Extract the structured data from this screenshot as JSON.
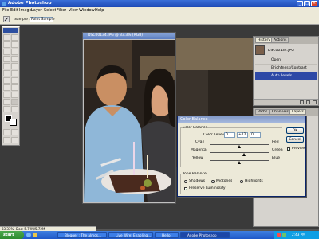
{
  "app": {
    "title": "Adobe Photoshop"
  },
  "menu": [
    "File",
    "Edit",
    "Image",
    "Layer",
    "Select",
    "Filter",
    "View",
    "Window",
    "Help"
  ],
  "options": {
    "sample_size_label": "Sample Size:",
    "sample_size_value": "Point Sample"
  },
  "document": {
    "title": "DSC00134.JPG @ 33.3% (RGB)",
    "zoom_status": "33.33%",
    "doc_status": "Doc: 5.72M/5.72M"
  },
  "history": {
    "tabs": [
      "History",
      "Actions"
    ],
    "snapshot": "DSC00134.JPG",
    "items": [
      "Open",
      "Brightness/Contrast",
      "Auto Levels"
    ]
  },
  "layers": {
    "tabs": [
      "Paths",
      "Channels",
      "Layers"
    ]
  },
  "color_balance": {
    "title": "Color Balance",
    "group_label": "Color Balance",
    "levels_label": "Color Levels:",
    "levels": [
      "0",
      "+12",
      "0"
    ],
    "sliders": [
      {
        "left": "Cyan",
        "right": "Red",
        "value": 0
      },
      {
        "left": "Magenta",
        "right": "Green",
        "value": 12
      },
      {
        "left": "Yellow",
        "right": "Blue",
        "value": 0
      }
    ],
    "tone_label": "Tone Balance",
    "tones": [
      "Shadows",
      "Midtones",
      "Highlights"
    ],
    "selected_tone": "Shadows",
    "preserve": "Preserve Luminosity",
    "ok": "OK",
    "cancel": "Cancel",
    "preview": "Preview"
  },
  "taskbar": {
    "start": "start",
    "buttons": [
      "Blogger : The almos...",
      "Live Wire: Enabling...",
      "Hello",
      "Adobe Photoshop"
    ],
    "active": "Adobe Photoshop",
    "clock": "2:43 PM"
  }
}
